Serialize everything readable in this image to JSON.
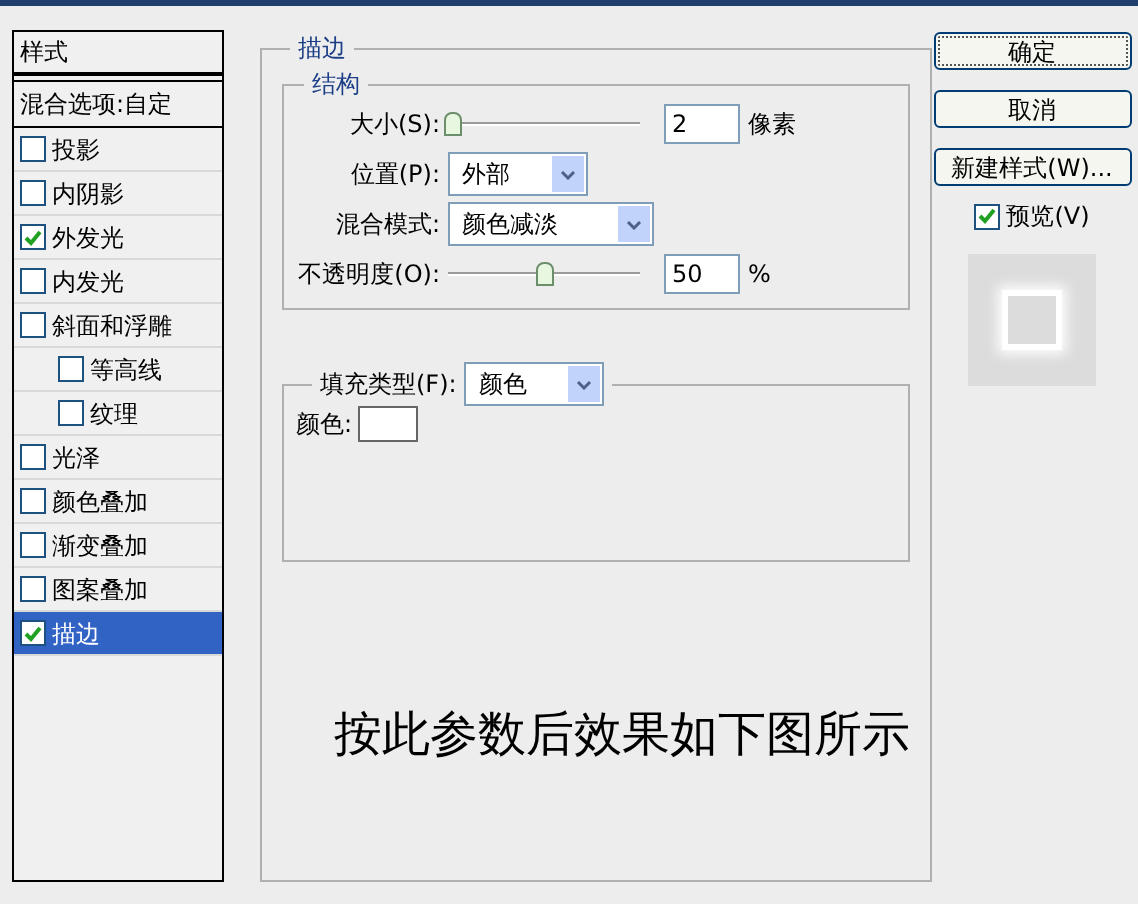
{
  "styles_panel": {
    "header": "样式",
    "blend_options": "混合选项:自定",
    "items": [
      {
        "label": "投影",
        "checked": false,
        "selected": false
      },
      {
        "label": "内阴影",
        "checked": false,
        "selected": false
      },
      {
        "label": "外发光",
        "checked": true,
        "selected": false
      },
      {
        "label": "内发光",
        "checked": false,
        "selected": false
      },
      {
        "label": "斜面和浮雕",
        "checked": false,
        "selected": false,
        "children": [
          {
            "label": "等高线",
            "checked": false,
            "selected": false
          },
          {
            "label": "纹理",
            "checked": false,
            "selected": false
          }
        ]
      },
      {
        "label": "光泽",
        "checked": false,
        "selected": false
      },
      {
        "label": "颜色叠加",
        "checked": false,
        "selected": false
      },
      {
        "label": "渐变叠加",
        "checked": false,
        "selected": false
      },
      {
        "label": "图案叠加",
        "checked": false,
        "selected": false
      },
      {
        "label": "描边",
        "checked": true,
        "selected": true
      }
    ]
  },
  "stroke": {
    "title": "描边",
    "structure": {
      "title": "结构",
      "size": {
        "label": "大小(S):",
        "level": 0.02,
        "value": "2",
        "unit": "像素"
      },
      "position": {
        "label": "位置(P):",
        "value": "外部"
      },
      "blend_mode": {
        "label": "混合模式:",
        "value": "颜色减淡"
      },
      "opacity": {
        "label": "不透明度(O):",
        "level": 0.5,
        "value": "50",
        "unit": "%"
      }
    },
    "fill": {
      "type_label": "填充类型(F):",
      "type_value": "颜色",
      "color_label": "颜色:",
      "color": "#ffffff"
    }
  },
  "buttons": [
    "确定",
    "取消",
    "新建样式(W)..."
  ],
  "preview": {
    "label": "预览(V)",
    "checked": true
  },
  "caption": "按此参数后效果如下图所示"
}
